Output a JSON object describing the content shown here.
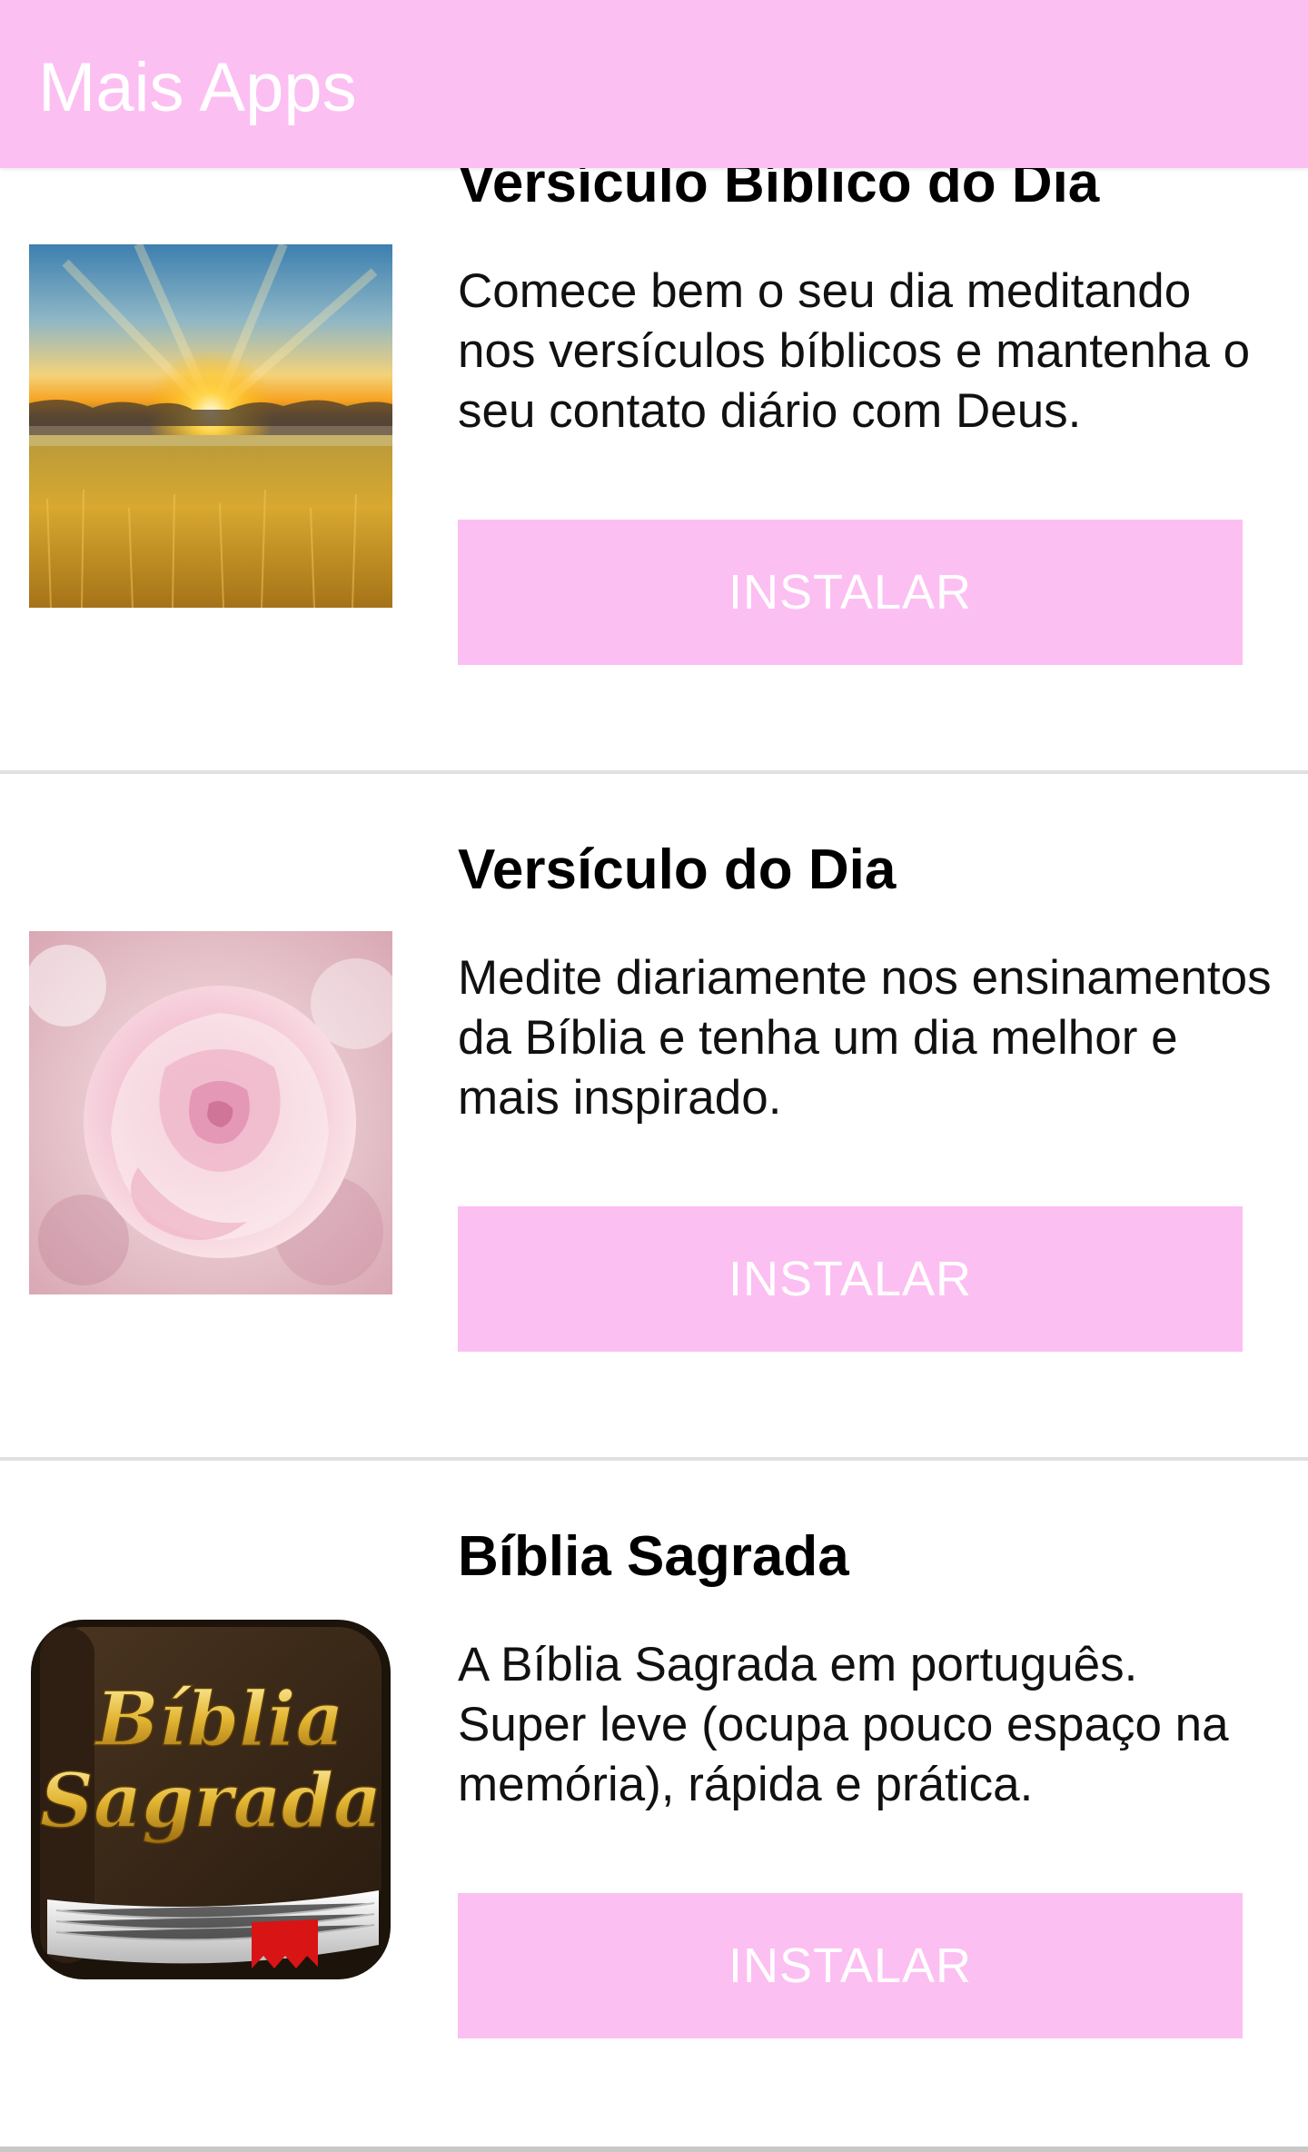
{
  "app_bar": {
    "title": "Mais Apps",
    "background_color": "#fcbff2"
  },
  "apps": [
    {
      "title": "Versículo Bíblico do Dia",
      "description": "Comece bem o seu dia meditando nos versículos bíblicos e mantenha o seu contato diário com Deus.",
      "install_label": "INSTALAR",
      "thumbnail": "sunrise-wheat-field-image"
    },
    {
      "title": "Versículo do Dia",
      "description": "Medite diariamente nos ensinamentos da Bíblia e tenha um dia melhor e mais inspirado.",
      "install_label": "INSTALAR",
      "thumbnail": "pink-rose-image"
    },
    {
      "title": "Bíblia Sagrada",
      "description": "A Bíblia Sagrada em português. Super leve (ocupa pouco espaço na memória), rápida e prática.",
      "install_label": "INSTALAR",
      "thumbnail": "holy-bible-book-icon",
      "icon_lettering": [
        "Bíblia",
        "Sagrada"
      ]
    }
  ],
  "colors": {
    "accent": "#fcbff2",
    "button_text": "#ffffff",
    "divider": "#e0e0e0"
  }
}
